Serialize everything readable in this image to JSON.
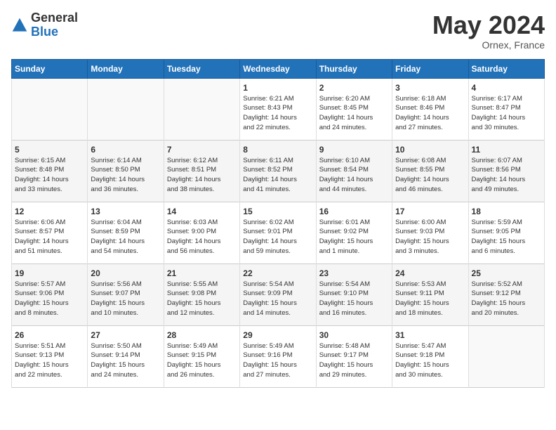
{
  "header": {
    "logo_general": "General",
    "logo_blue": "Blue",
    "month_title": "May 2024",
    "location": "Ornex, France"
  },
  "days_of_week": [
    "Sunday",
    "Monday",
    "Tuesday",
    "Wednesday",
    "Thursday",
    "Friday",
    "Saturday"
  ],
  "weeks": [
    [
      {
        "day": "",
        "content": ""
      },
      {
        "day": "",
        "content": ""
      },
      {
        "day": "",
        "content": ""
      },
      {
        "day": "1",
        "content": "Sunrise: 6:21 AM\nSunset: 8:43 PM\nDaylight: 14 hours\nand 22 minutes."
      },
      {
        "day": "2",
        "content": "Sunrise: 6:20 AM\nSunset: 8:45 PM\nDaylight: 14 hours\nand 24 minutes."
      },
      {
        "day": "3",
        "content": "Sunrise: 6:18 AM\nSunset: 8:46 PM\nDaylight: 14 hours\nand 27 minutes."
      },
      {
        "day": "4",
        "content": "Sunrise: 6:17 AM\nSunset: 8:47 PM\nDaylight: 14 hours\nand 30 minutes."
      }
    ],
    [
      {
        "day": "5",
        "content": "Sunrise: 6:15 AM\nSunset: 8:48 PM\nDaylight: 14 hours\nand 33 minutes."
      },
      {
        "day": "6",
        "content": "Sunrise: 6:14 AM\nSunset: 8:50 PM\nDaylight: 14 hours\nand 36 minutes."
      },
      {
        "day": "7",
        "content": "Sunrise: 6:12 AM\nSunset: 8:51 PM\nDaylight: 14 hours\nand 38 minutes."
      },
      {
        "day": "8",
        "content": "Sunrise: 6:11 AM\nSunset: 8:52 PM\nDaylight: 14 hours\nand 41 minutes."
      },
      {
        "day": "9",
        "content": "Sunrise: 6:10 AM\nSunset: 8:54 PM\nDaylight: 14 hours\nand 44 minutes."
      },
      {
        "day": "10",
        "content": "Sunrise: 6:08 AM\nSunset: 8:55 PM\nDaylight: 14 hours\nand 46 minutes."
      },
      {
        "day": "11",
        "content": "Sunrise: 6:07 AM\nSunset: 8:56 PM\nDaylight: 14 hours\nand 49 minutes."
      }
    ],
    [
      {
        "day": "12",
        "content": "Sunrise: 6:06 AM\nSunset: 8:57 PM\nDaylight: 14 hours\nand 51 minutes."
      },
      {
        "day": "13",
        "content": "Sunrise: 6:04 AM\nSunset: 8:59 PM\nDaylight: 14 hours\nand 54 minutes."
      },
      {
        "day": "14",
        "content": "Sunrise: 6:03 AM\nSunset: 9:00 PM\nDaylight: 14 hours\nand 56 minutes."
      },
      {
        "day": "15",
        "content": "Sunrise: 6:02 AM\nSunset: 9:01 PM\nDaylight: 14 hours\nand 59 minutes."
      },
      {
        "day": "16",
        "content": "Sunrise: 6:01 AM\nSunset: 9:02 PM\nDaylight: 15 hours\nand 1 minute."
      },
      {
        "day": "17",
        "content": "Sunrise: 6:00 AM\nSunset: 9:03 PM\nDaylight: 15 hours\nand 3 minutes."
      },
      {
        "day": "18",
        "content": "Sunrise: 5:59 AM\nSunset: 9:05 PM\nDaylight: 15 hours\nand 6 minutes."
      }
    ],
    [
      {
        "day": "19",
        "content": "Sunrise: 5:57 AM\nSunset: 9:06 PM\nDaylight: 15 hours\nand 8 minutes."
      },
      {
        "day": "20",
        "content": "Sunrise: 5:56 AM\nSunset: 9:07 PM\nDaylight: 15 hours\nand 10 minutes."
      },
      {
        "day": "21",
        "content": "Sunrise: 5:55 AM\nSunset: 9:08 PM\nDaylight: 15 hours\nand 12 minutes."
      },
      {
        "day": "22",
        "content": "Sunrise: 5:54 AM\nSunset: 9:09 PM\nDaylight: 15 hours\nand 14 minutes."
      },
      {
        "day": "23",
        "content": "Sunrise: 5:54 AM\nSunset: 9:10 PM\nDaylight: 15 hours\nand 16 minutes."
      },
      {
        "day": "24",
        "content": "Sunrise: 5:53 AM\nSunset: 9:11 PM\nDaylight: 15 hours\nand 18 minutes."
      },
      {
        "day": "25",
        "content": "Sunrise: 5:52 AM\nSunset: 9:12 PM\nDaylight: 15 hours\nand 20 minutes."
      }
    ],
    [
      {
        "day": "26",
        "content": "Sunrise: 5:51 AM\nSunset: 9:13 PM\nDaylight: 15 hours\nand 22 minutes."
      },
      {
        "day": "27",
        "content": "Sunrise: 5:50 AM\nSunset: 9:14 PM\nDaylight: 15 hours\nand 24 minutes."
      },
      {
        "day": "28",
        "content": "Sunrise: 5:49 AM\nSunset: 9:15 PM\nDaylight: 15 hours\nand 26 minutes."
      },
      {
        "day": "29",
        "content": "Sunrise: 5:49 AM\nSunset: 9:16 PM\nDaylight: 15 hours\nand 27 minutes."
      },
      {
        "day": "30",
        "content": "Sunrise: 5:48 AM\nSunset: 9:17 PM\nDaylight: 15 hours\nand 29 minutes."
      },
      {
        "day": "31",
        "content": "Sunrise: 5:47 AM\nSunset: 9:18 PM\nDaylight: 15 hours\nand 30 minutes."
      },
      {
        "day": "",
        "content": ""
      }
    ]
  ]
}
